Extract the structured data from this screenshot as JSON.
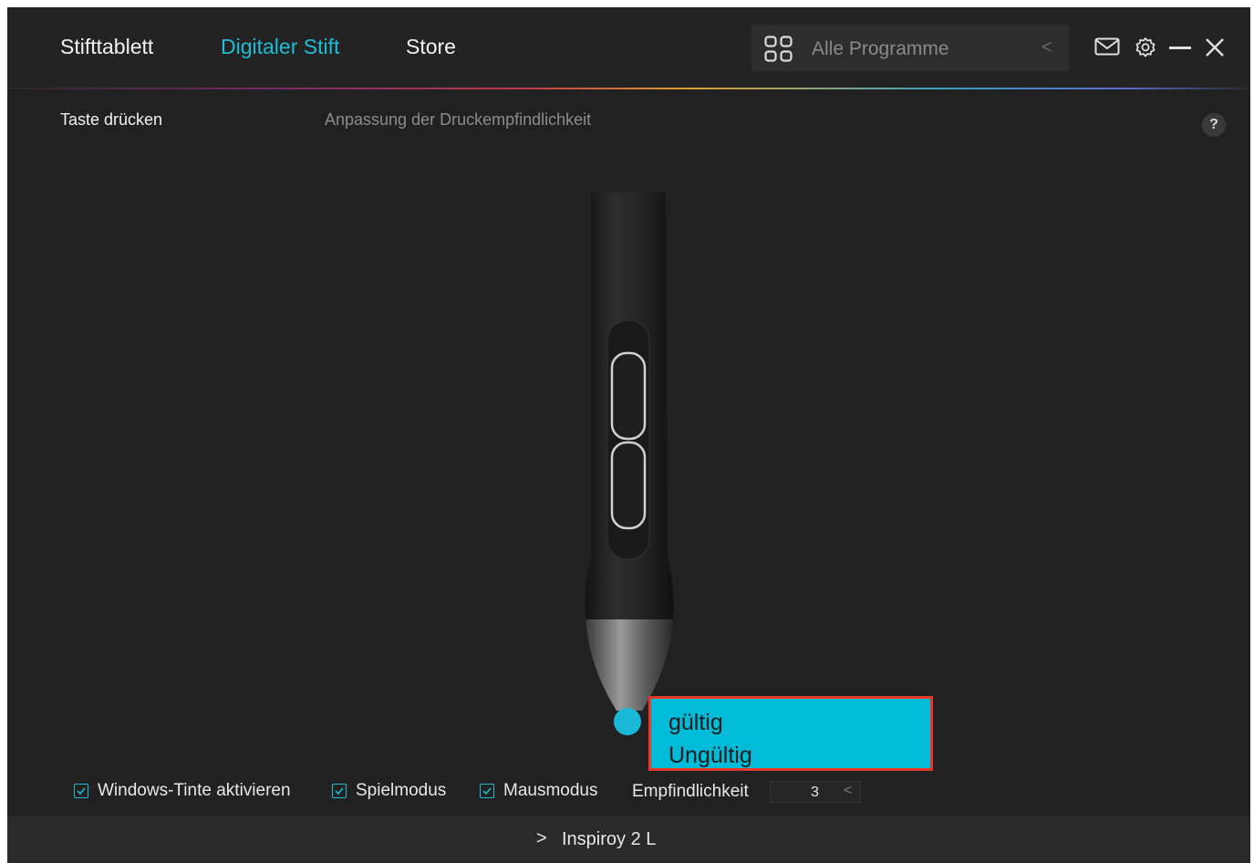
{
  "nav": {
    "tabs": [
      {
        "label": "Stifttablett",
        "active": false
      },
      {
        "label": "Digitaler Stift",
        "active": true
      },
      {
        "label": "Store",
        "active": false
      }
    ]
  },
  "search": {
    "placeholder": "Alle Programme",
    "chevron": "<"
  },
  "window_controls": [
    "mail-icon",
    "settings-icon",
    "minimize-icon",
    "close-icon"
  ],
  "subtabs": [
    {
      "label": "Taste drücken",
      "active": true
    },
    {
      "label": "Anpassung der Druckempfindlichkeit",
      "active": false
    }
  ],
  "help": "?",
  "tip_dropdown": {
    "options": [
      "gültig",
      "Ungültig"
    ]
  },
  "options": {
    "windows_ink": {
      "label": "Windows-Tinte aktivieren",
      "checked": true
    },
    "game_mode": {
      "label": "Spielmodus",
      "checked": true
    },
    "mouse_mode": {
      "label": "Mausmodus",
      "checked": true
    },
    "sensitivity": {
      "label": "Empfindlichkeit",
      "value": "3"
    }
  },
  "footer": {
    "device": "Inspiroy 2 L"
  },
  "colors": {
    "accent": "#20bcd6",
    "dropdown_bg": "#00bcd8",
    "highlight_border": "#e8382a",
    "background": "#212121"
  }
}
